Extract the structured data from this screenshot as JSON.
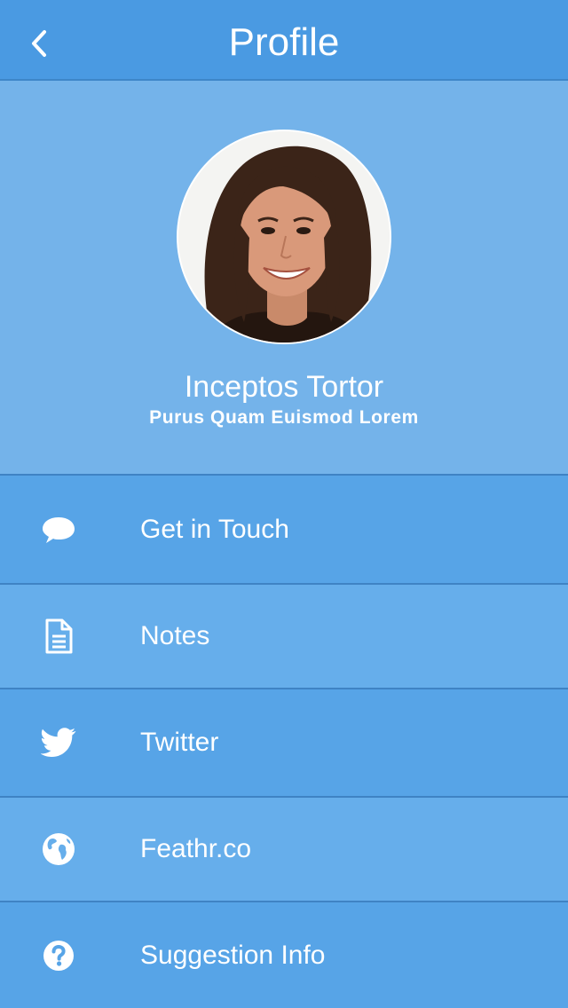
{
  "navbar": {
    "title": "Profile",
    "back_icon": "chevron-left-icon"
  },
  "profile": {
    "name": "Inceptos Tortor",
    "subtitle": "Purus Quam Euismod Lorem"
  },
  "menu": {
    "items": [
      {
        "label": "Get in Touch",
        "icon": "chat-bubble-icon"
      },
      {
        "label": "Notes",
        "icon": "document-icon"
      },
      {
        "label": "Twitter",
        "icon": "twitter-bird-icon"
      },
      {
        "label": "Feathr.co",
        "icon": "globe-icon"
      },
      {
        "label": "Suggestion Info",
        "icon": "question-circle-icon"
      }
    ]
  },
  "colors": {
    "navbar": "#4a9ae2",
    "hero": "#74b3ea",
    "row_dark": "#57a4e7",
    "row_light": "#66aeeb",
    "divider": "#3f83c4",
    "text": "#ffffff"
  }
}
